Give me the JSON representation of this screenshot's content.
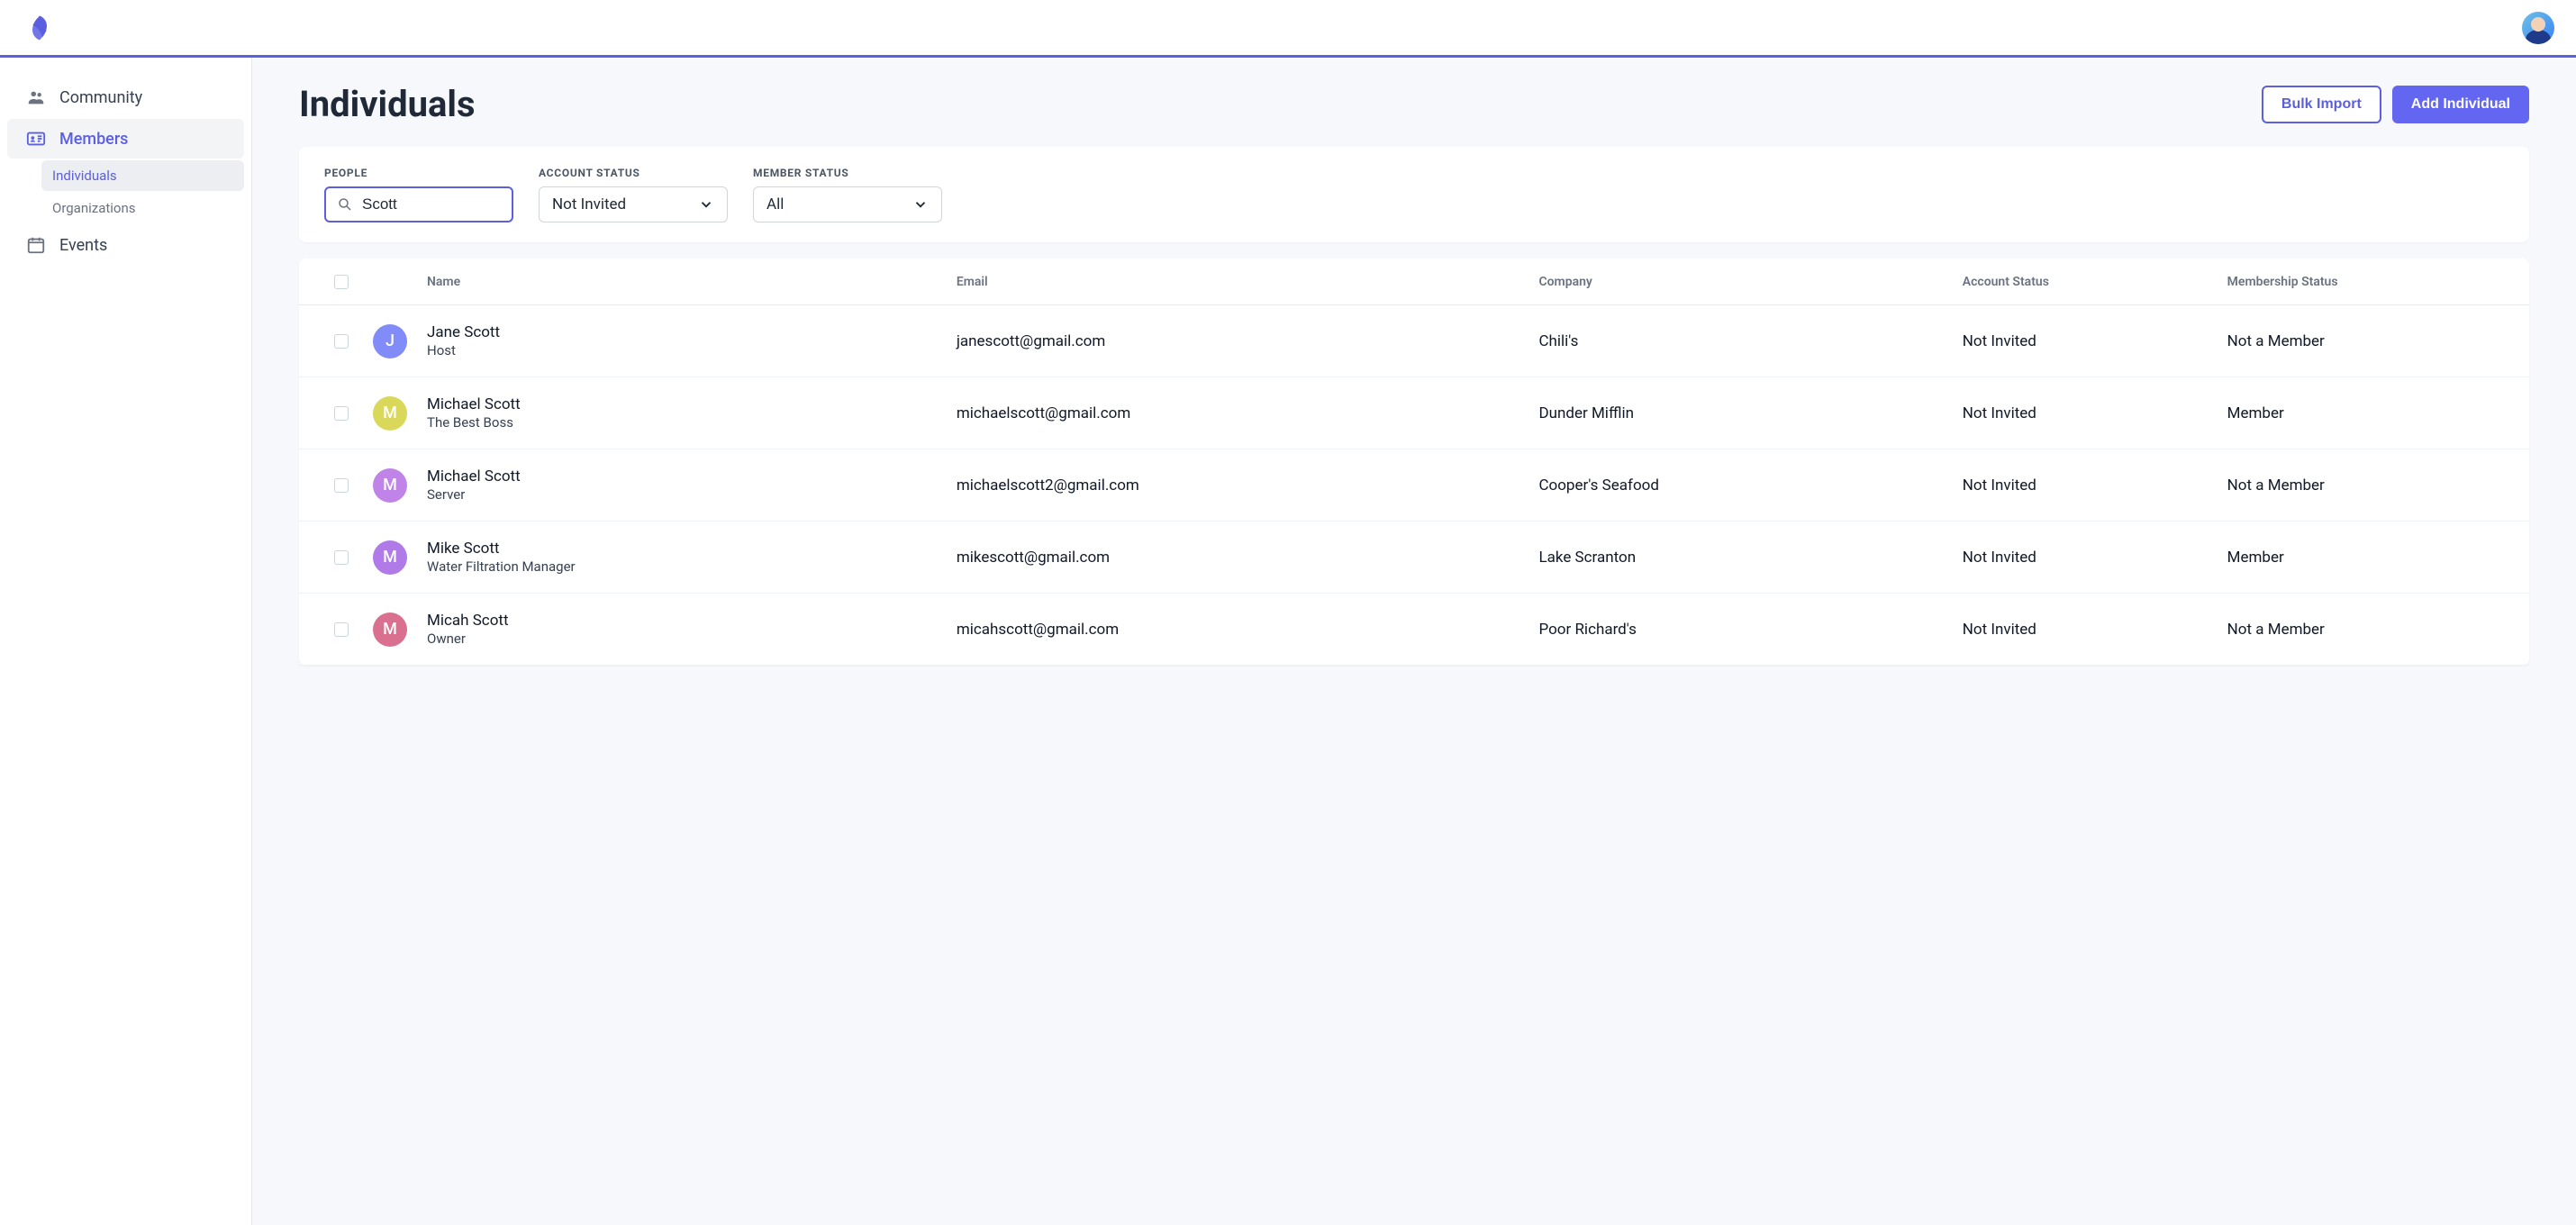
{
  "sidebar": {
    "community": "Community",
    "members": "Members",
    "members_sub": {
      "individuals": "Individuals",
      "organizations": "Organizations"
    },
    "events": "Events"
  },
  "page": {
    "title": "Individuals",
    "bulk_import": "Bulk Import",
    "add_individual": "Add Individual"
  },
  "filters": {
    "people_label": "PEOPLE",
    "search_value": "Scott",
    "account_status_label": "ACCOUNT STATUS",
    "account_status_value": "Not Invited",
    "member_status_label": "MEMBER STATUS",
    "member_status_value": "All"
  },
  "table": {
    "headers": {
      "name": "Name",
      "email": "Email",
      "company": "Company",
      "account_status": "Account Status",
      "membership_status": "Membership Status"
    },
    "rows": [
      {
        "initial": "J",
        "avatar_color": "#818cf8",
        "name": "Jane Scott",
        "role": "Host",
        "email": "janescott@gmail.com",
        "company": "Chili's",
        "account_status": "Not Invited",
        "membership_status": "Not a Member"
      },
      {
        "initial": "M",
        "avatar_color": "#d9d85a",
        "name": "Michael Scott",
        "role": "The Best Boss",
        "email": "michaelscott@gmail.com",
        "company": "Dunder Mifflin",
        "account_status": "Not Invited",
        "membership_status": "Member"
      },
      {
        "initial": "M",
        "avatar_color": "#c084e8",
        "name": "Michael Scott",
        "role": "Server",
        "email": "michaelscott2@gmail.com",
        "company": "Cooper's Seafood",
        "account_status": "Not Invited",
        "membership_status": "Not a Member"
      },
      {
        "initial": "M",
        "avatar_color": "#b07ae8",
        "name": "Mike Scott",
        "role": "Water Filtration Manager",
        "email": "mikescott@gmail.com",
        "company": "Lake Scranton",
        "account_status": "Not Invited",
        "membership_status": "Member"
      },
      {
        "initial": "M",
        "avatar_color": "#d9708f",
        "name": "Micah Scott",
        "role": "Owner",
        "email": "micahscott@gmail.com",
        "company": "Poor Richard's",
        "account_status": "Not Invited",
        "membership_status": "Not a Member"
      }
    ]
  }
}
